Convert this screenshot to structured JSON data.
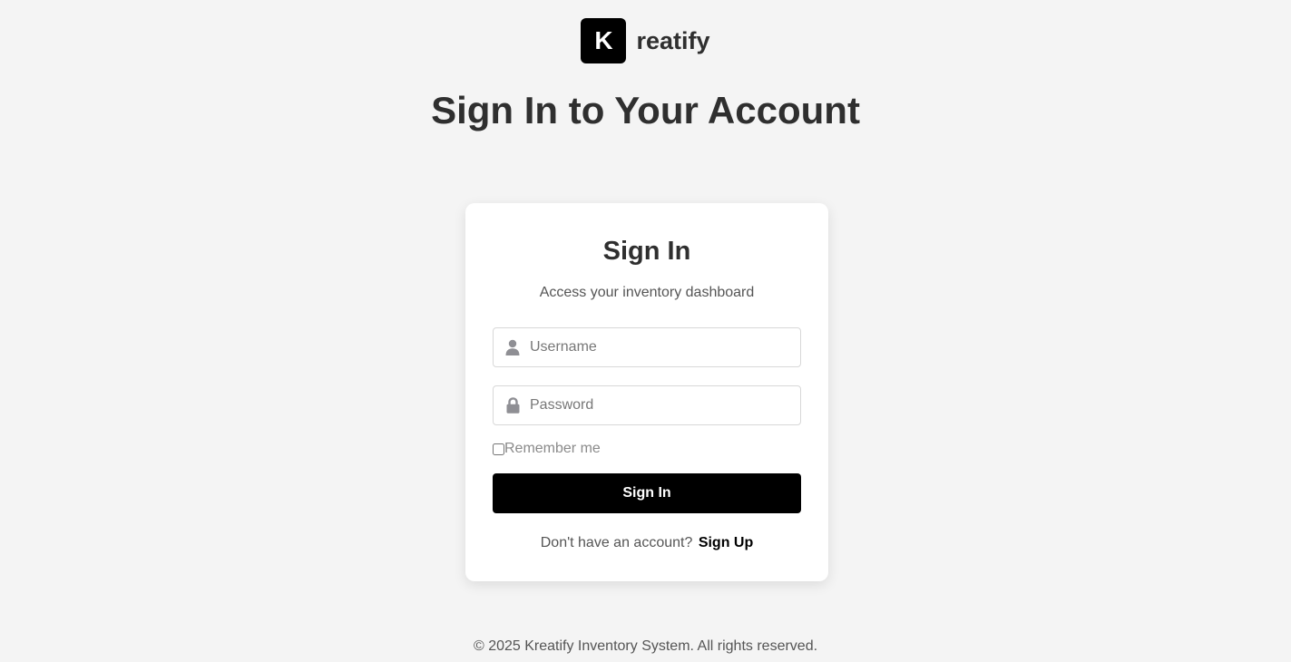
{
  "brand": {
    "mark_letter": "K",
    "name": "reatify",
    "mark_color": "#000000"
  },
  "page": {
    "title": "Sign In to Your Account"
  },
  "card": {
    "title": "Sign In",
    "subtitle": "Access your inventory dashboard",
    "username": {
      "icon": "user-icon",
      "placeholder": "Username",
      "value": ""
    },
    "password": {
      "icon": "lock-icon",
      "placeholder": "Password",
      "value": ""
    },
    "remember": {
      "label": "Remember me",
      "checked": false
    },
    "submit_label": "Sign In",
    "signup_prompt": "Don't have an account?",
    "signup_link": "Sign Up"
  },
  "footer": {
    "text": "© 2025 Kreatify Inventory System. All rights reserved."
  },
  "colors": {
    "background": "#f4f4f4",
    "card": "#ffffff",
    "button": "#000000",
    "button_text": "#ffffff",
    "icon": "#8f8f94"
  }
}
